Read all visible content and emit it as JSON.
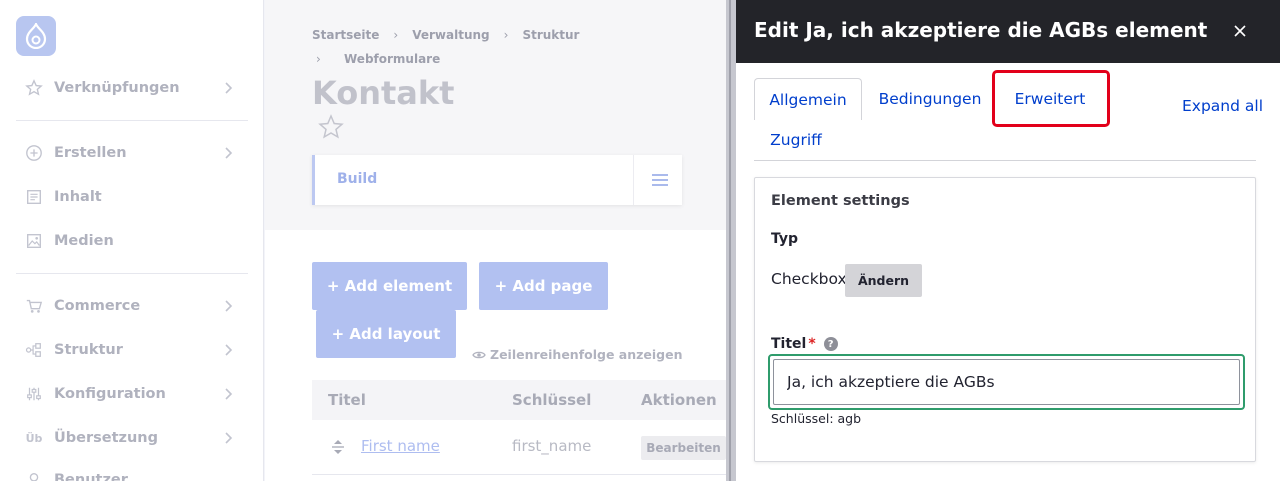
{
  "sidebar": {
    "items": [
      {
        "label": "Verknüpfungen",
        "icon": "star-icon"
      },
      {
        "label": "Erstellen",
        "icon": "plus-circle-icon"
      },
      {
        "label": "Inhalt",
        "icon": "document-icon"
      },
      {
        "label": "Medien",
        "icon": "image-icon"
      },
      {
        "label": "Commerce",
        "icon": "cart-icon"
      },
      {
        "label": "Struktur",
        "icon": "structure-icon"
      },
      {
        "label": "Konfiguration",
        "icon": "sliders-icon"
      },
      {
        "label": "Übersetzung",
        "icon": "translate-icon"
      },
      {
        "label": "Benutzer",
        "icon": "user-icon"
      }
    ]
  },
  "main": {
    "breadcrumbs": [
      "Startseite",
      "Verwaltung",
      "Struktur",
      "Webformulare"
    ],
    "title": "Kontakt",
    "build_tab": "Build",
    "buttons": {
      "add_element": "+ Add element",
      "add_page": "+ Add page",
      "add_layout": "+ Add layout"
    },
    "row_order_toggle": "Zeilenreihenfolge anzeigen",
    "table": {
      "headers": [
        "Titel",
        "Schlüssel",
        "Aktionen"
      ],
      "rows": [
        {
          "title": "First name",
          "key": "first_name",
          "action": "Bearbeiten"
        }
      ]
    }
  },
  "dialog": {
    "title": "Edit Ja, ich akzeptiere die AGBs element",
    "tabs": [
      "Allgemein",
      "Bedingungen",
      "Erweitert",
      "Zugriff"
    ],
    "active_tab": "Allgemein",
    "highlighted_tab": "Erweitert",
    "expand_all": "Expand all",
    "fieldset_title": "Element settings",
    "type_label": "Typ",
    "type_value": "Checkbox",
    "change_button": "Ändern",
    "title_label": "Titel",
    "required_mark": "*",
    "help_mark": "?",
    "title_value": "Ja, ich akzeptiere die AGBs",
    "machine_key": "Schlüssel: agb"
  },
  "colors": {
    "link": "#003ecc",
    "dialog_header": "#232429",
    "focus_border": "#2f9c6c",
    "highlight_box": "#e2001a",
    "required": "#dc2323"
  }
}
